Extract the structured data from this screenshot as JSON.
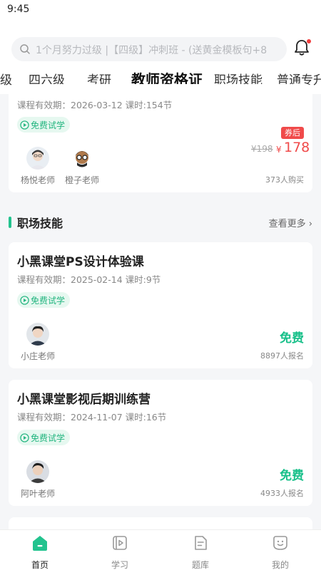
{
  "status_bar": {
    "time": "9:45"
  },
  "search": {
    "placeholder": "1个月努力过级 |【四级】冲刺班 - (送黄金模板句+8"
  },
  "tabs": [
    {
      "label": "级"
    },
    {
      "label": "四六级"
    },
    {
      "label": "考研"
    },
    {
      "label": "教师资格证",
      "active": true
    },
    {
      "label": "职场技能"
    },
    {
      "label": "普通专升本"
    }
  ],
  "courses_top": {
    "meta": "课程有效期：2026-03-12   课时:154节",
    "trial": "免费试学",
    "teachers": [
      {
        "name": "杨悦老师"
      },
      {
        "name": "橙子老师"
      }
    ],
    "coupon": "券后",
    "price_old": "¥198",
    "price_symbol": "¥",
    "price_new": "178",
    "buyers": "373人购买"
  },
  "section": {
    "title": "职场技能",
    "more": "查看更多"
  },
  "courses": [
    {
      "title": "小黑课堂PS设计体验课",
      "meta": "课程有效期：2025-02-14   课时:9节",
      "trial": "免费试学",
      "teacher": "小庄老师",
      "price": "免费",
      "count": "8897人报名"
    },
    {
      "title": "小黑课堂影视后期训练营",
      "meta": "课程有效期：2024-11-07   课时:16节",
      "trial": "免费试学",
      "teacher": "阿叶老师",
      "price": "免费",
      "count": "4933人报名"
    }
  ],
  "tabbar": [
    {
      "label": "首页",
      "icon": "home-icon",
      "active": true
    },
    {
      "label": "学习",
      "icon": "study-icon"
    },
    {
      "label": "题库",
      "icon": "question-bank-icon"
    },
    {
      "label": "我的",
      "icon": "profile-icon"
    }
  ],
  "colors": {
    "accent": "#22c38e",
    "price_red": "#f04a4a",
    "free_green": "#19c08a"
  }
}
